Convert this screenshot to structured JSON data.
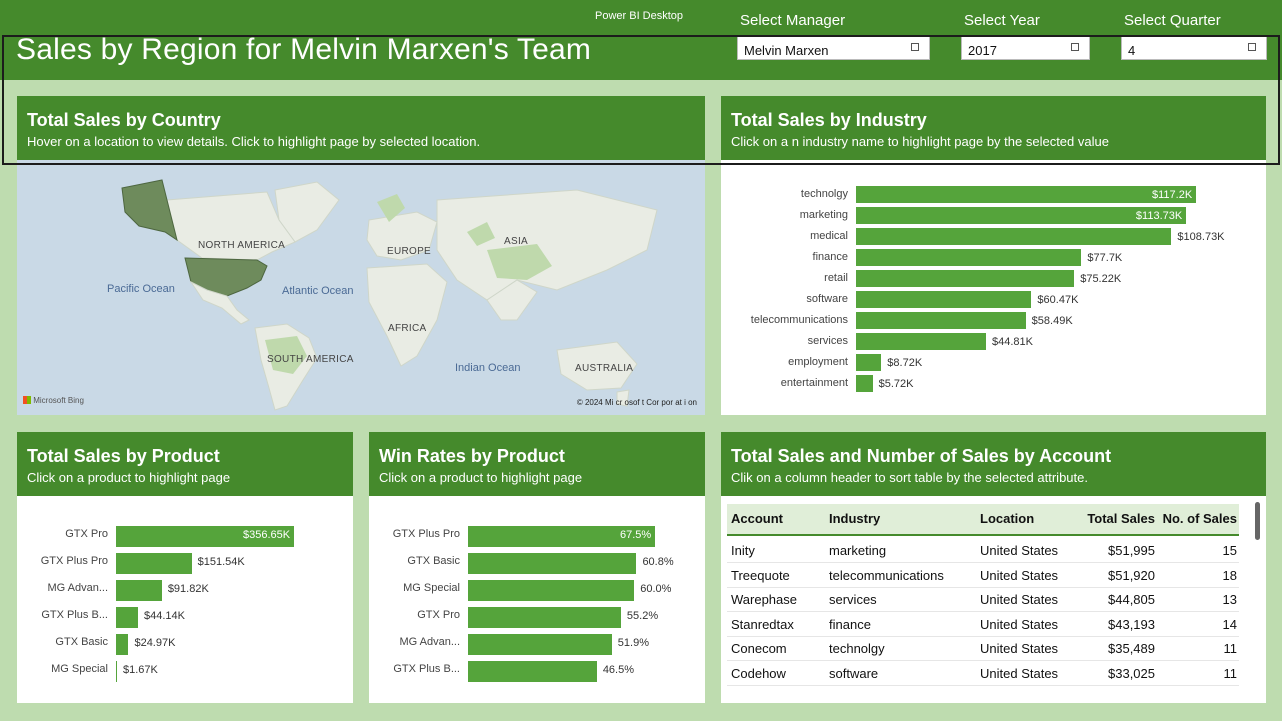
{
  "app": {
    "title": "Power BI Desktop"
  },
  "page": {
    "title": "Sales by Region for Melvin Marxen's Team"
  },
  "slicers": {
    "manager": {
      "label": "Select Manager",
      "value": "Melvin Marxen"
    },
    "year": {
      "label": "Select Year",
      "value": "2017"
    },
    "quarter": {
      "label": "Select Quarter",
      "value": "4"
    }
  },
  "country_card": {
    "title": "Total Sales by Country",
    "subtitle": "Hover on a location to view details. Click to highlight page by selected location.",
    "map_labels": {
      "north_america": "NORTH AMERICA",
      "europe": "EUROPE",
      "asia": "ASIA",
      "africa": "AFRICA",
      "south_america": "SOUTH AMERICA",
      "australia": "AUSTRALIA",
      "pacific": "Pacific Ocean",
      "atlantic": "Atlantic Ocean",
      "indian": "Indian Ocean"
    },
    "attribution": "Microsoft Bing",
    "copyright": "© 2024 Mi cr osof t  Cor por at i on"
  },
  "industry_card": {
    "title": "Total Sales by Industry",
    "subtitle": "Click on a n industry name to highlight page by the selected value"
  },
  "product_card": {
    "title": "Total Sales by Product",
    "subtitle": "Click on a product to highlight page"
  },
  "winrate_card": {
    "title": "Win Rates by Product",
    "subtitle": "Click on a product to highlight page"
  },
  "account_card": {
    "title": "Total Sales and Number of Sales by Account",
    "subtitle": "Clik on a column header to sort table by the selected attribute.",
    "columns": [
      "Account",
      "Industry",
      "Location",
      "Total Sales",
      "No. of Sales"
    ],
    "rows": [
      [
        "Inity",
        "marketing",
        "United States",
        "$51,995",
        "15"
      ],
      [
        "Treequote",
        "telecommunications",
        "United States",
        "$51,920",
        "18"
      ],
      [
        "Warephase",
        "services",
        "United States",
        "$44,805",
        "13"
      ],
      [
        "Stanredtax",
        "finance",
        "United States",
        "$43,193",
        "14"
      ],
      [
        "Conecom",
        "technolgy",
        "United States",
        "$35,489",
        "11"
      ],
      [
        "Codehow",
        "software",
        "United States",
        "$33,025",
        "11"
      ]
    ]
  },
  "chart_data": [
    {
      "type": "bar",
      "orientation": "horizontal",
      "title": "Total Sales by Industry",
      "categories": [
        "technolgy",
        "marketing",
        "medical",
        "finance",
        "retail",
        "software",
        "telecommunications",
        "services",
        "employment",
        "entertainment"
      ],
      "values": [
        117200,
        113730,
        108730,
        77700,
        75220,
        60470,
        58490,
        44810,
        8720,
        5720
      ],
      "labels": [
        "$117.2K",
        "$113.73K",
        "$108.73K",
        "$77.7K",
        "$75.22K",
        "$60.47K",
        "$58.49K",
        "$44.81K",
        "$8.72K",
        "$5.72K"
      ],
      "inside_label_count": 2,
      "color": "#55a43b"
    },
    {
      "type": "bar",
      "orientation": "horizontal",
      "title": "Total Sales by Product",
      "categories": [
        "GTX Pro",
        "GTX Plus Pro",
        "MG Advan...",
        "GTX Plus B...",
        "GTX Basic",
        "MG Special"
      ],
      "values": [
        356650,
        151540,
        91820,
        44140,
        24970,
        1670
      ],
      "labels": [
        "$356.65K",
        "$151.54K",
        "$91.82K",
        "$44.14K",
        "$24.97K",
        "$1.67K"
      ],
      "inside_label_count": 1,
      "color": "#55a43b"
    },
    {
      "type": "bar",
      "orientation": "horizontal",
      "title": "Win Rates by Product",
      "categories": [
        "GTX Plus Pro",
        "GTX Basic",
        "MG Special",
        "GTX Pro",
        "MG Advan...",
        "GTX Plus B..."
      ],
      "values": [
        67.5,
        60.8,
        60.0,
        55.2,
        51.9,
        46.5
      ],
      "labels": [
        "67.5%",
        "60.8%",
        "60.0%",
        "55.2%",
        "51.9%",
        "46.5%"
      ],
      "inside_label_count": 1,
      "color": "#55a43b"
    }
  ],
  "colors": {
    "header_green": "#458a2c",
    "bar_green": "#55a43b",
    "page_bg": "#bedcaf"
  }
}
